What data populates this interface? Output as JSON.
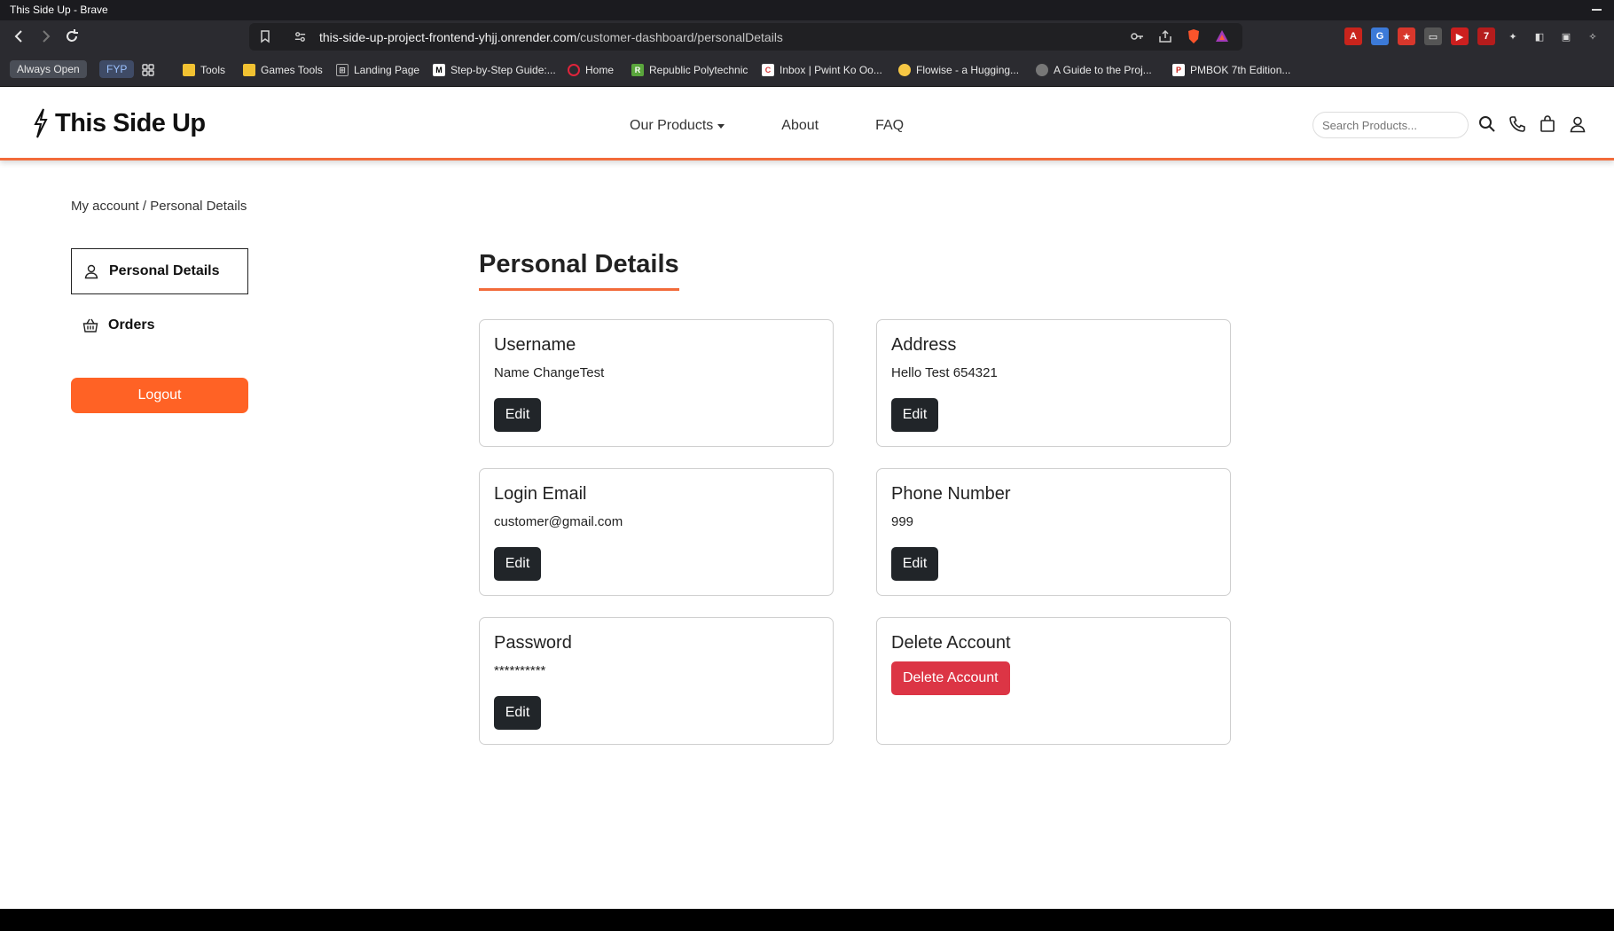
{
  "window": {
    "title": "This Side Up - Brave"
  },
  "browser": {
    "url_host": "this-side-up-project-frontend-yhjj.onrender.com",
    "url_path": "/customer-dashboard/personalDetails",
    "bookmark_tags": [
      "Always Open",
      "FYP"
    ],
    "bookmarks": [
      {
        "label": "Tools",
        "icon": "folder-icon"
      },
      {
        "label": "Games Tools",
        "icon": "folder-icon"
      },
      {
        "label": "Landing Page",
        "icon": "grid-icon"
      },
      {
        "label": "Step-by-Step Guide:...",
        "icon": "medium-icon"
      },
      {
        "label": "Home",
        "icon": "opera-icon"
      },
      {
        "label": "Republic Polytechnic",
        "icon": "rp-icon"
      },
      {
        "label": "Inbox | Pwint Ko Oo...",
        "icon": "mail-icon"
      },
      {
        "label": "Flowise - a Hugging...",
        "icon": "hugging-face-icon"
      },
      {
        "label": "A Guide to the Proj...",
        "icon": "globe-icon"
      },
      {
        "label": "PMBOK 7th Edition...",
        "icon": "pdf-icon"
      }
    ]
  },
  "header": {
    "brand": "This Side Up",
    "nav": {
      "products": "Our Products",
      "about": "About",
      "faq": "FAQ"
    },
    "search_placeholder": "Search Products..."
  },
  "breadcrumb": "My account / Personal Details",
  "sidebar": {
    "personal_details": "Personal Details",
    "orders": "Orders",
    "logout": "Logout"
  },
  "main": {
    "title": "Personal Details",
    "cards": {
      "username": {
        "title": "Username",
        "value": "Name ChangeTest",
        "button": "Edit"
      },
      "address": {
        "title": "Address",
        "value": "Hello Test 654321",
        "button": "Edit"
      },
      "email": {
        "title": "Login Email",
        "value": "customer@gmail.com",
        "button": "Edit"
      },
      "phone": {
        "title": "Phone Number",
        "value": "999",
        "button": "Edit"
      },
      "password": {
        "title": "Password",
        "value": "**********",
        "button": "Edit"
      },
      "delete": {
        "title": "Delete Account",
        "button": "Delete Account"
      }
    }
  },
  "colors": {
    "accent": "#f26b3a",
    "logout": "#ff6225",
    "danger": "#dc3545",
    "dark_button": "#212529"
  }
}
